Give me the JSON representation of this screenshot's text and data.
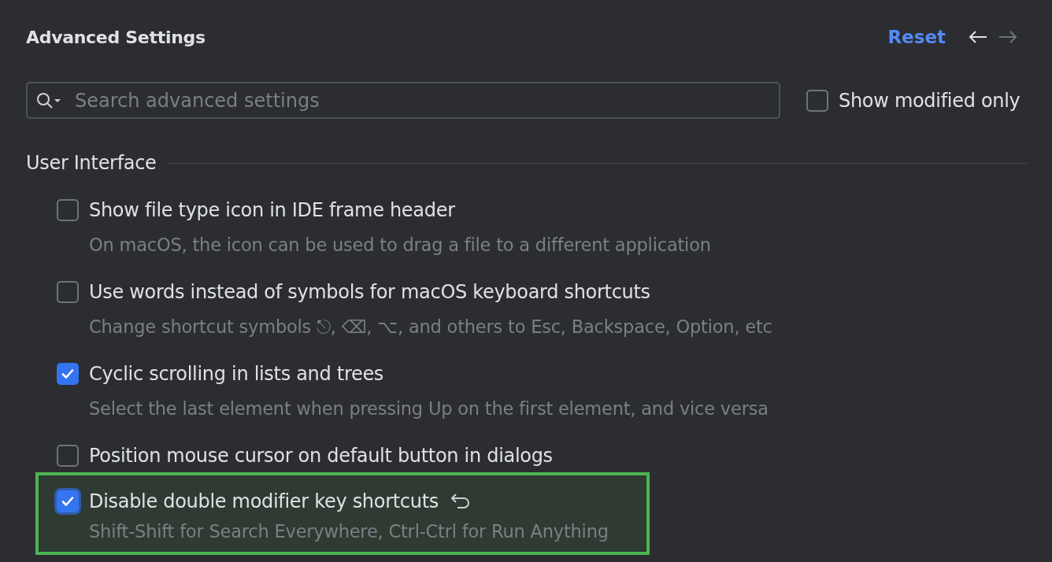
{
  "header": {
    "title": "Advanced Settings",
    "reset": "Reset",
    "back_enabled": true,
    "forward_enabled": false
  },
  "search": {
    "placeholder": "Search advanced settings"
  },
  "show_modified_only": {
    "label": "Show modified only",
    "checked": false
  },
  "section": {
    "title": "User Interface",
    "items": [
      {
        "label": "Show file type icon in IDE frame header",
        "description": "On macOS, the icon can be used to drag a file to a different application",
        "checked": false,
        "modified": false
      },
      {
        "label": "Use words instead of symbols for macOS keyboard shortcuts",
        "description": "Change shortcut symbols ⎋, ⌫, ⌥, and others to Esc, Backspace, Option, etc",
        "checked": false,
        "modified": false
      },
      {
        "label": "Cyclic scrolling in lists and trees",
        "description": "Select the last element when pressing Up on the first element, and vice versa",
        "checked": true,
        "modified": false
      },
      {
        "label": "Position mouse cursor on default button in dialogs",
        "checked": false,
        "modified": false
      },
      {
        "label": "Disable double modifier key shortcuts",
        "description": "Shift-Shift for Search Everywhere, Ctrl-Ctrl for Run Anything",
        "checked": true,
        "modified": true
      }
    ]
  }
}
